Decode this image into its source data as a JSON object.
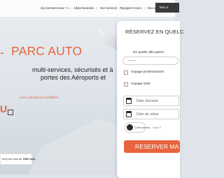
{
  "nav": {
    "items": [
      {
        "label": "Qui sommes-nous ?",
        "has_dropdown": true
      },
      {
        "label": "Allyse Business",
        "has_dropdown": false
      },
      {
        "label": "Nos services",
        "has_dropdown": false
      },
      {
        "label": "Rejoignez-nous",
        "has_dropdown": true
      },
      {
        "label": "Nos actus",
        "has_dropdown": false
      }
    ],
    "right_button_label": "Mon e"
  },
  "hero": {
    "title": "PARC AUTO",
    "desc_line1": "multi-services, sécurisés et à",
    "desc_line2": "portes des Aéroports et",
    "desc_line3": "",
    "subline": "eurs convaincus et fidèles",
    "letter": "U",
    "reviews_text": "ées) sur plus de ",
    "reviews_count": "1900 avis"
  },
  "booking": {
    "title": "RÉSERVEZ EN QUELC",
    "question": "De quelle ville partez",
    "city_placeholder": "-------",
    "option_pro": "Voyage professionnel",
    "option_leisure": "Voyage loisir",
    "arrival_placeholder": "Date d'arrivée",
    "return_placeholder": "Date de retour",
    "promo_label": "Code promo",
    "promo_note": "Tous l'O",
    "submit_label": "RÉSERVER MA"
  },
  "colors": {
    "accent": "#e8643c",
    "nav_button": "#3a3a3a",
    "panel": "#ffffff"
  }
}
